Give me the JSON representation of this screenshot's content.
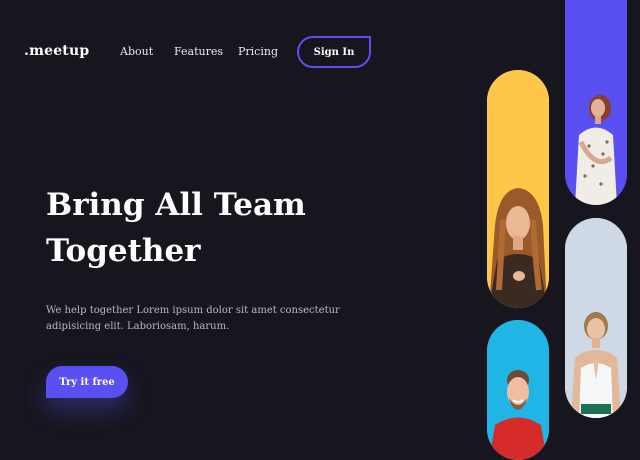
{
  "nav": {
    "logo": ".meetup",
    "links": [
      "About",
      "Features",
      "Pricing"
    ],
    "signin": "Sign In"
  },
  "hero": {
    "title_line1": "Bring All Team",
    "title_line2": "Together",
    "description": "We help together Lorem ipsum dolor sit amet consectetur adipisicing elit. Laboriosam, harum.",
    "cta": "Try it free"
  },
  "colors": {
    "background": "#17161f",
    "accent": "#5a4ff0",
    "yellow": "#ffc74a",
    "grey": "#cfd8e5",
    "cyan": "#1fb6e6"
  },
  "images": [
    {
      "name": "woman-floral-dress-photo"
    },
    {
      "name": "woman-long-hair-photo"
    },
    {
      "name": "woman-praying-hands-photo"
    },
    {
      "name": "man-smiling-photo"
    }
  ]
}
